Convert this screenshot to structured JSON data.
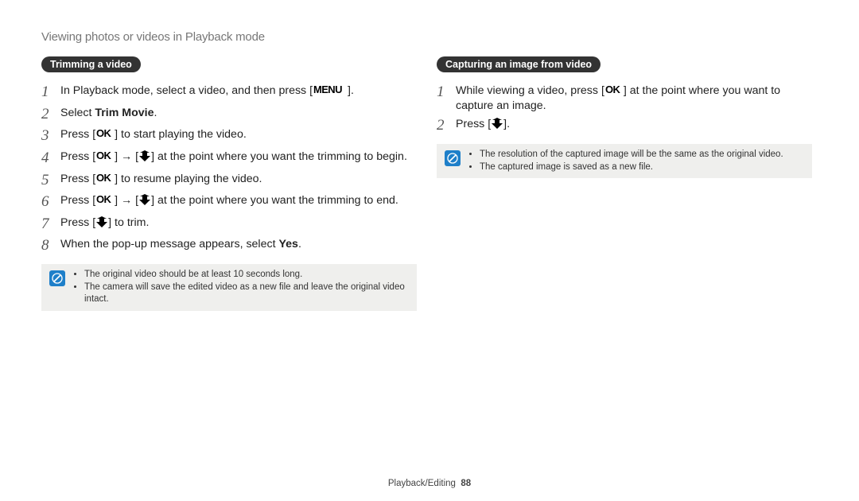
{
  "header": "Viewing photos or videos in Playback mode",
  "left": {
    "badge": "Trimming a video",
    "steps": [
      {
        "n": "1",
        "segments": [
          {
            "t": "text",
            "v": "In Playback mode, select a video, and then press ["
          },
          {
            "t": "icon",
            "v": "menu"
          },
          {
            "t": "text",
            "v": "]."
          }
        ]
      },
      {
        "n": "2",
        "segments": [
          {
            "t": "text",
            "v": "Select "
          },
          {
            "t": "bold",
            "v": "Trim Movie"
          },
          {
            "t": "text",
            "v": "."
          }
        ]
      },
      {
        "n": "3",
        "segments": [
          {
            "t": "text",
            "v": "Press ["
          },
          {
            "t": "icon",
            "v": "ok"
          },
          {
            "t": "text",
            "v": "] to start playing the video."
          }
        ]
      },
      {
        "n": "4",
        "segments": [
          {
            "t": "text",
            "v": "Press ["
          },
          {
            "t": "icon",
            "v": "ok"
          },
          {
            "t": "text",
            "v": "] → ["
          },
          {
            "t": "icon",
            "v": "down"
          },
          {
            "t": "text",
            "v": "] at the point where you want the trimming to begin."
          }
        ]
      },
      {
        "n": "5",
        "segments": [
          {
            "t": "text",
            "v": "Press ["
          },
          {
            "t": "icon",
            "v": "ok"
          },
          {
            "t": "text",
            "v": "] to resume playing the video."
          }
        ]
      },
      {
        "n": "6",
        "segments": [
          {
            "t": "text",
            "v": "Press ["
          },
          {
            "t": "icon",
            "v": "ok"
          },
          {
            "t": "text",
            "v": "] → ["
          },
          {
            "t": "icon",
            "v": "down"
          },
          {
            "t": "text",
            "v": "] at the point where you want the trimming to end."
          }
        ]
      },
      {
        "n": "7",
        "segments": [
          {
            "t": "text",
            "v": "Press ["
          },
          {
            "t": "icon",
            "v": "down"
          },
          {
            "t": "text",
            "v": "] to trim."
          }
        ]
      },
      {
        "n": "8",
        "segments": [
          {
            "t": "text",
            "v": "When the pop-up message appears, select "
          },
          {
            "t": "bold",
            "v": "Yes"
          },
          {
            "t": "text",
            "v": "."
          }
        ]
      }
    ],
    "notes": [
      "The original video should be at least 10 seconds long.",
      "The camera will save the edited video as a new file and leave the original video intact."
    ]
  },
  "right": {
    "badge": "Capturing an image from video",
    "steps": [
      {
        "n": "1",
        "segments": [
          {
            "t": "text",
            "v": "While viewing a video, press ["
          },
          {
            "t": "icon",
            "v": "ok"
          },
          {
            "t": "text",
            "v": "] at the point where you want to capture an image."
          }
        ]
      },
      {
        "n": "2",
        "segments": [
          {
            "t": "text",
            "v": "Press ["
          },
          {
            "t": "icon",
            "v": "down"
          },
          {
            "t": "text",
            "v": "]."
          }
        ]
      }
    ],
    "notes": [
      "The resolution of the captured image will be the same as the original video.",
      "The captured image is saved as a new file."
    ]
  },
  "footer": {
    "section": "Playback/Editing",
    "page": "88"
  }
}
